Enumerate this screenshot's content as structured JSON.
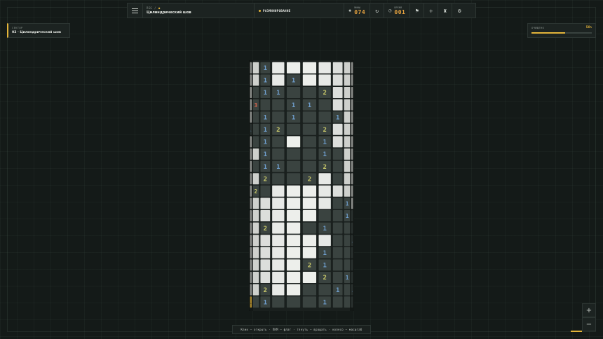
{
  "header": {
    "crumb_code": "RSG",
    "crumb_sep": "/",
    "crumb_marker": "●",
    "level_name": "Цилиндрический шов",
    "status": "РАЗМИНИРОВАНИЕ",
    "mines_label": "МИНЫ",
    "mines_value": "074",
    "time_label": "ВРЕМЯ",
    "time_value": "001"
  },
  "icons": {
    "menu": "menu-icon",
    "restart": "↻",
    "clock": "◷",
    "flag": "⚑",
    "crosshair": "✛",
    "trophy": "♜",
    "settings": "⚙",
    "mine": "✹"
  },
  "sector": {
    "label": "СЕКТОР",
    "value": "02 · Цилиндрический шов"
  },
  "progress": {
    "label": "ОЧИЩЕНО",
    "percent_text": "56%",
    "fraction": 0.56
  },
  "hint": "Клик — открыть · ПКМ — флаг · тянуть — вращать · колесо — масштаб",
  "zoom": {
    "in": "+",
    "out": "−"
  },
  "colors": {
    "accent": "#e3b43a",
    "tile_closed": "#eef0ec",
    "tile_open": "#3a4340",
    "n1": "#6f9fce",
    "n2": "#c9c96a",
    "n3": "#d9674f"
  },
  "board": {
    "rows": 20,
    "cols": 10,
    "cells": [
      "CC1CCCCCCC",
      "CC1C1CCCCC",
      "C.11..2CCC",
      "C3..11.CCC",
      "C.1.1..1CC",
      "1.12..2CCC",
      "C.1.C.1CCC",
      "CC1...1.CC",
      "C.11..2.CC",
      "CC2..2C.CC",
      "C2.CCCCCCC",
      "CCCCCCC.1C",
      "CCCCCC..1.",
      "CC2CC.1...",
      "CCCCCCC..1",
      "CCCCCC1...",
      "CCCCC21...",
      "CCCCCC2.1.",
      "CC2CC..1.1",
      "F.1...1..."
    ]
  }
}
